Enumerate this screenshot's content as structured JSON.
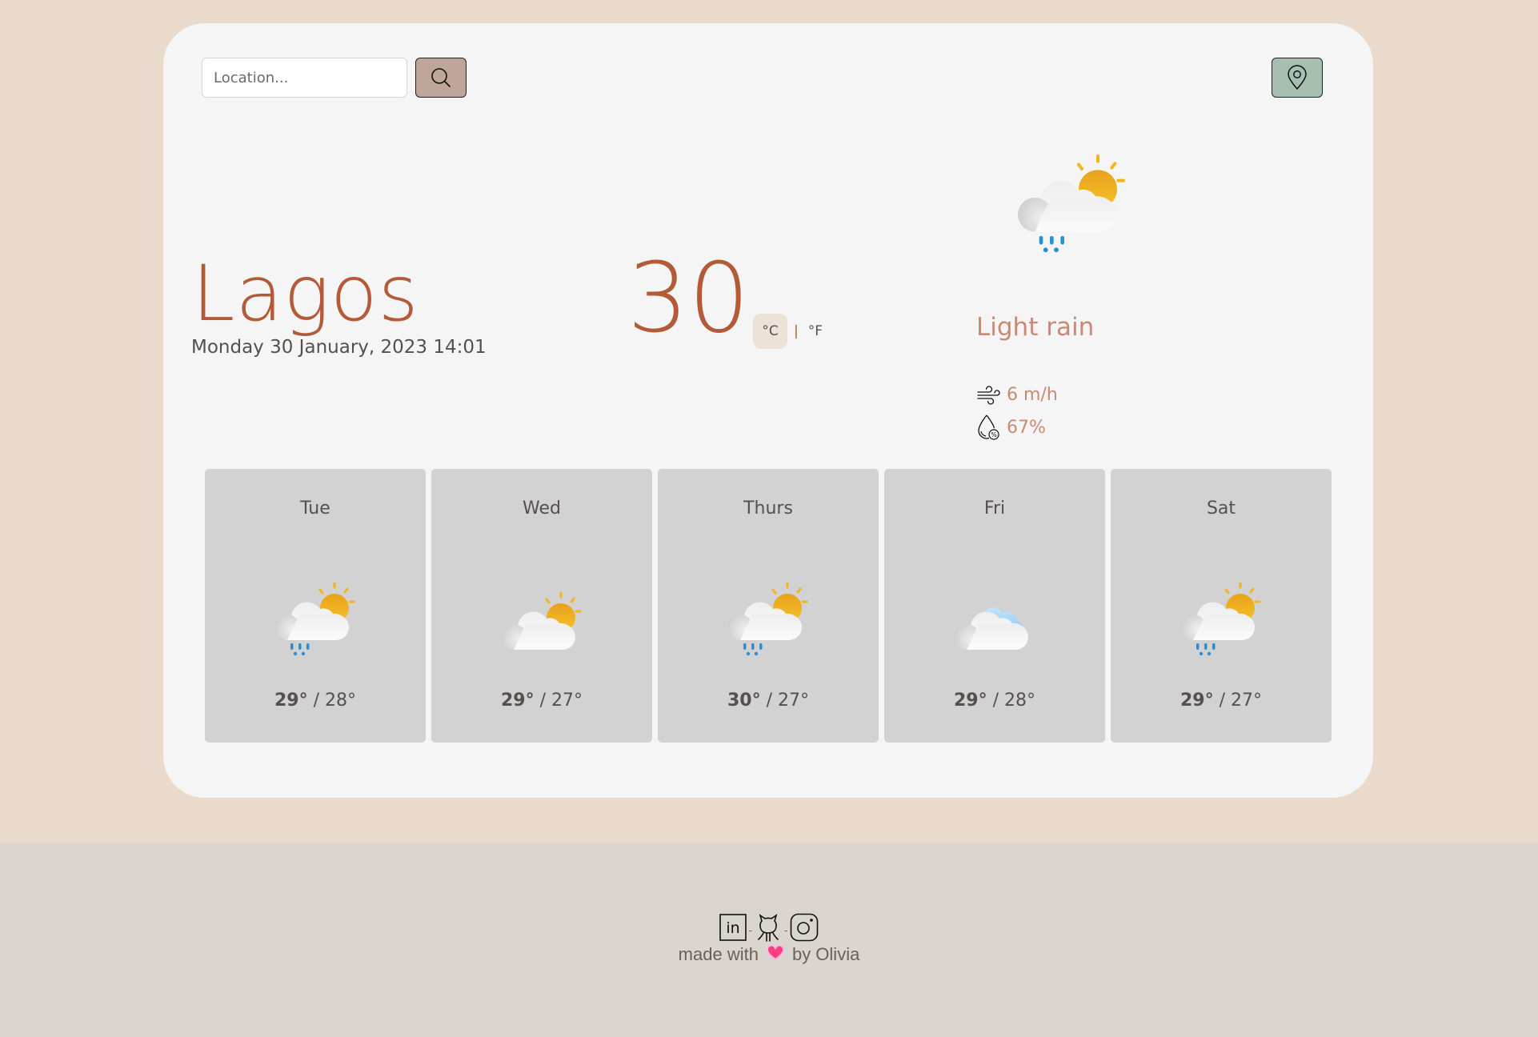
{
  "search": {
    "placeholder": "Location...",
    "value": ""
  },
  "current": {
    "city": "Lagos",
    "datetime": "Monday 30 January, 2023 14:01",
    "temperature": "30",
    "unit_celsius": "°C",
    "unit_separator": "|",
    "unit_fahrenheit": "°F",
    "active_unit": "celsius",
    "description": "Light rain",
    "icon": "partly-cloudy-rain-icon",
    "wind": "6 m/h",
    "humidity": "67%"
  },
  "forecast": [
    {
      "day": "Tue",
      "high": "29°",
      "low": "28°",
      "icon": "partly-cloudy-rain"
    },
    {
      "day": "Wed",
      "high": "29°",
      "low": "27°",
      "icon": "partly-cloudy"
    },
    {
      "day": "Thurs",
      "high": "30°",
      "low": "27°",
      "icon": "partly-cloudy-rain"
    },
    {
      "day": "Fri",
      "high": "29°",
      "low": "28°",
      "icon": "cloudy"
    },
    {
      "day": "Sat",
      "high": "29°",
      "low": "27°",
      "icon": "partly-cloudy-rain"
    }
  ],
  "footer": {
    "made_with": "made with",
    "by": "by Olivia",
    "socials": [
      "linkedin",
      "github",
      "instagram"
    ],
    "separator": "-"
  },
  "colors": {
    "accent": "#b35a38",
    "description": "#c98a73",
    "search_button": "#bfa59a",
    "location_button": "#a6bfb0",
    "page_bg": "#e9dacc",
    "card_bg": "#f5f5f5",
    "forecast_bg": "#d2d2d2",
    "footer_bg": "#dad5cf"
  }
}
